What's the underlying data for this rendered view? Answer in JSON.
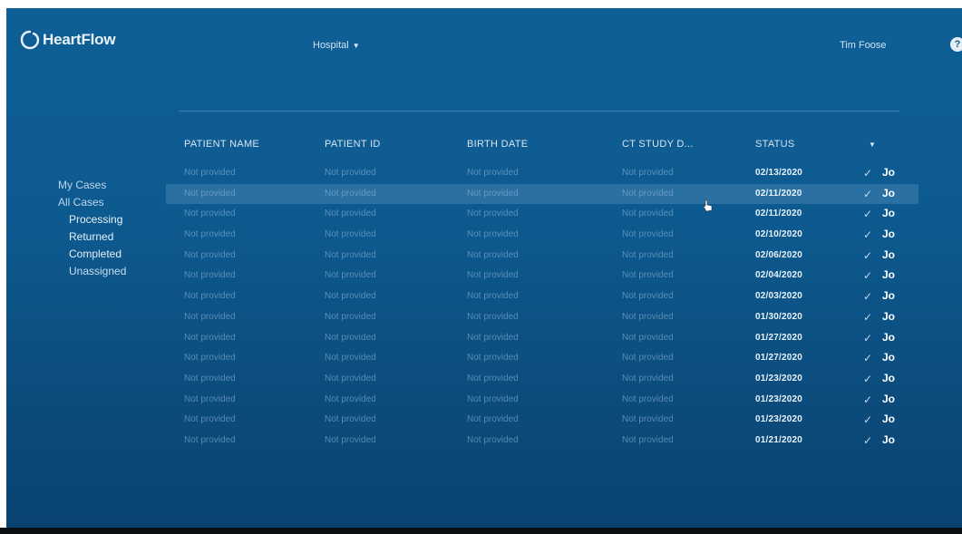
{
  "header": {
    "logo_text": "HeartFlow",
    "hospital_dropdown": "Hospital",
    "user_name": "Tim Foose",
    "help_label": "?"
  },
  "sidebar": {
    "my_cases": "My Cases",
    "all_cases": "All Cases",
    "sub_items": [
      "Processing",
      "Returned",
      "Completed",
      "Unassigned"
    ]
  },
  "table": {
    "headers": [
      "PATIENT NAME",
      "PATIENT ID",
      "BIRTH DATE",
      "CT STUDY D...",
      "STATUS"
    ],
    "rows": [
      {
        "name": "Not provided",
        "id": "Not provided",
        "birth": "Not provided",
        "ct": "Not provided",
        "status": "02/13/2020",
        "check": "✓",
        "assignee": "Jo"
      },
      {
        "name": "Not provided",
        "id": "Not provided",
        "birth": "Not provided",
        "ct": "Not provided",
        "status": "02/11/2020",
        "check": "✓",
        "assignee": "Jo"
      },
      {
        "name": "Not provided",
        "id": "Not provided",
        "birth": "Not provided",
        "ct": "Not provided",
        "status": "02/11/2020",
        "check": "✓",
        "assignee": "Jo"
      },
      {
        "name": "Not provided",
        "id": "Not provided",
        "birth": "Not provided",
        "ct": "Not provided",
        "status": "02/10/2020",
        "check": "✓",
        "assignee": "Jo"
      },
      {
        "name": "Not provided",
        "id": "Not provided",
        "birth": "Not provided",
        "ct": "Not provided",
        "status": "02/06/2020",
        "check": "✓",
        "assignee": "Jo"
      },
      {
        "name": "Not provided",
        "id": "Not provided",
        "birth": "Not provided",
        "ct": "Not provided",
        "status": "02/04/2020",
        "check": "✓",
        "assignee": "Jo"
      },
      {
        "name": "Not provided",
        "id": "Not provided",
        "birth": "Not provided",
        "ct": "Not provided",
        "status": "02/03/2020",
        "check": "✓",
        "assignee": "Jo"
      },
      {
        "name": "Not provided",
        "id": "Not provided",
        "birth": "Not provided",
        "ct": "Not provided",
        "status": "01/30/2020",
        "check": "✓",
        "assignee": "Jo"
      },
      {
        "name": "Not provided",
        "id": "Not provided",
        "birth": "Not provided",
        "ct": "Not provided",
        "status": "01/27/2020",
        "check": "✓",
        "assignee": "Jo"
      },
      {
        "name": "Not provided",
        "id": "Not provided",
        "birth": "Not provided",
        "ct": "Not provided",
        "status": "01/27/2020",
        "check": "✓",
        "assignee": "Jo"
      },
      {
        "name": "Not provided",
        "id": "Not provided",
        "birth": "Not provided",
        "ct": "Not provided",
        "status": "01/23/2020",
        "check": "✓",
        "assignee": "Jo"
      },
      {
        "name": "Not provided",
        "id": "Not provided",
        "birth": "Not provided",
        "ct": "Not provided",
        "status": "01/23/2020",
        "check": "✓",
        "assignee": "Jo"
      },
      {
        "name": "Not provided",
        "id": "Not provided",
        "birth": "Not provided",
        "ct": "Not provided",
        "status": "01/23/2020",
        "check": "✓",
        "assignee": "Jo"
      },
      {
        "name": "Not provided",
        "id": "Not provided",
        "birth": "Not provided",
        "ct": "Not provided",
        "status": "01/21/2020",
        "check": "✓",
        "assignee": "Jo"
      }
    ],
    "selected_row": 1
  },
  "colors": {
    "background_top": "#0f5f97",
    "background_bottom": "#0a4372",
    "selected_row": "#4f88b5"
  }
}
